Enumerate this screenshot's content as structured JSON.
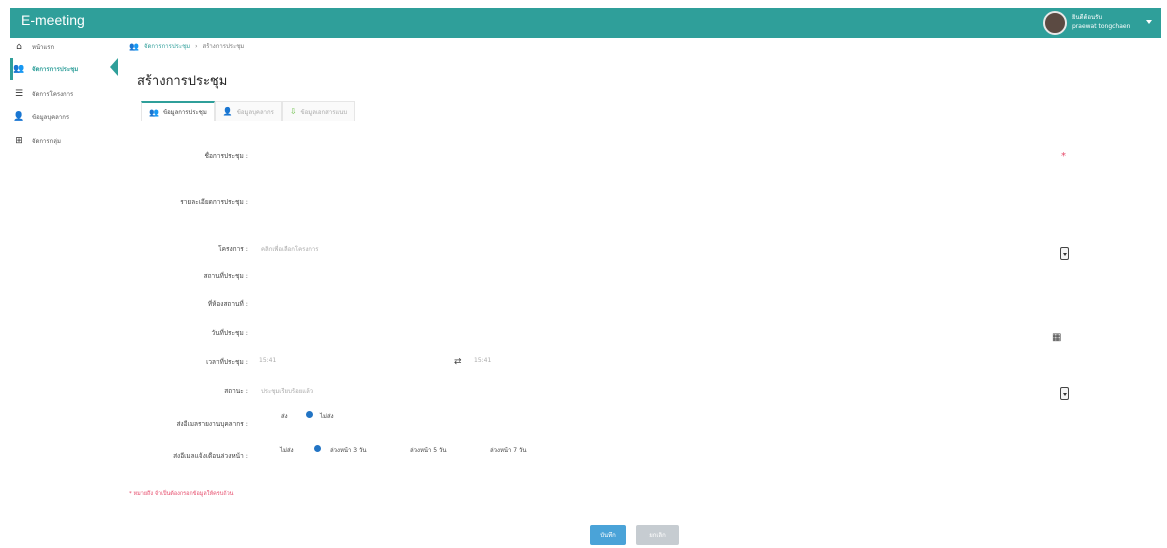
{
  "topbar": {
    "title": "E-meeting",
    "user_line1": "ยินดีต้อนรับ",
    "user_line2": "praewat tongchaen"
  },
  "sidebar": {
    "items": [
      {
        "icon": "home-icon",
        "label": "หน้าแรก"
      },
      {
        "icon": "users-icon",
        "label": "จัดการการประชุม"
      },
      {
        "icon": "list-icon",
        "label": "จัดการโครงการ"
      },
      {
        "icon": "user-icon",
        "label": "ข้อมูลบุคลากร"
      },
      {
        "icon": "plus-square-icon",
        "label": "จัดการกลุ่ม"
      }
    ]
  },
  "breadcrumb": {
    "parent": "จัดการการประชุม",
    "separator": "›",
    "current": "สร้างการประชุม"
  },
  "page": {
    "title": "สร้างการประชุม"
  },
  "tabs": [
    {
      "icon": "users-icon",
      "label": "ข้อมูลการประชุม",
      "color": "#2f9f9a"
    },
    {
      "icon": "user-icon",
      "label": "ข้อมูลบุคลากร",
      "color": "#e64a6a"
    },
    {
      "icon": "download-icon",
      "label": "ข้อมูลเอกสารแนบ",
      "color": "#6cbf4a"
    }
  ],
  "form": {
    "meeting_name_label": "ชื่อการประชุม :",
    "meeting_detail_label": "รายละเอียดการประชุม :",
    "project_label": "โครงการ :",
    "project_placeholder": "คลิกเพื่อเลือกโครงการ",
    "location_label": "สถานที่ประชุม :",
    "room_label": "ที่ห้องสถานที่ :",
    "date_label": "วันที่ประชุม :",
    "time_label": "เวลาที่ประชุม :",
    "time_start": "15:41",
    "time_end": "15:41",
    "status_label": "สถานะ :",
    "status_placeholder": "ประชุมเรียบร้อยแล้ว",
    "send_agenda_label": "ส่งอีเมลรายงานบุคลากร :",
    "send_agenda_options": [
      "ส่ง",
      "ไม่ส่ง"
    ],
    "send_agenda_selected": "ไม่ส่ง",
    "reminder_label": "ส่งอีเมลแจ้งเตือนล่วงหน้า :",
    "reminder_options": [
      "ไม่ส่ง",
      "ล่วงหน้า 3 วัน",
      "ล่วงหน้า 5 วัน",
      "ล่วงหน้า 7 วัน"
    ],
    "reminder_selected": "ล่วงหน้า 3 วัน",
    "required_mark": "*"
  },
  "note": "* หมายถึง จำเป็นต้องกรอกข้อมูลให้ครบถ้วน",
  "buttons": {
    "save": "บันทึก",
    "cancel": "ยกเลิก"
  },
  "colors": {
    "accent": "#2f9f9a",
    "required": "#e64a6a",
    "primary_button": "#4aa3d8",
    "radio": "#2274c4"
  }
}
